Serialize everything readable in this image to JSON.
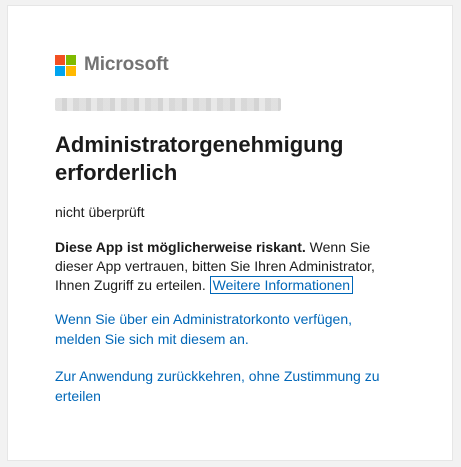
{
  "brand": {
    "name": "Microsoft",
    "logo_colors": [
      "#f25022",
      "#7fba00",
      "#00a4ef",
      "#ffb900"
    ]
  },
  "account": {
    "redacted": true
  },
  "dialog": {
    "title": "Administratorgenehmigung erforderlich",
    "subtitle": "nicht überprüft",
    "warning_bold": "Diese App ist möglicherweise riskant.",
    "warning_text": " Wenn Sie dieser App vertrauen, bitten Sie Ihren Administrator, Ihnen Zugriff zu erteilen. ",
    "more_info_link": "Weitere Informationen",
    "admin_link": "Wenn Sie über ein Administratorkonto verfügen, melden Sie sich mit diesem an.",
    "return_link": "Zur Anwendung zurückkehren, ohne Zustimmung zu erteilen"
  },
  "colors": {
    "link": "#0067b8",
    "text": "#1b1b1b",
    "brand_text": "#737373"
  }
}
